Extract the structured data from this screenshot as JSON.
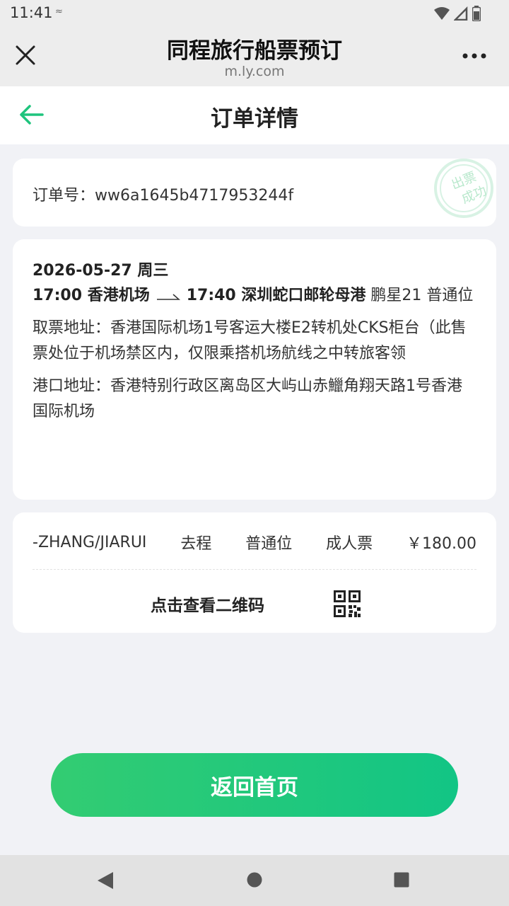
{
  "status_bar": {
    "time": "11:41",
    "note": "≈"
  },
  "webview": {
    "title": "同程旅行船票预订",
    "domain": "m.ly.com"
  },
  "page": {
    "title": "订单详情"
  },
  "order": {
    "number_label": "订单号：ww6a1645b4717953244f",
    "stamp_line1": "出票",
    "stamp_line2": "成功"
  },
  "trip": {
    "date": "2026-05-27 周三",
    "depart_time_place": "17:00 香港机场",
    "arrive_time_place": "17:40 深圳蛇口邮轮母港",
    "vessel_class": "鹏星21 普通位",
    "pickup_address": "取票地址：香港国际机场1号客运大楼E2转机处CKS柜台（此售票处位于机场禁区内，仅限乘搭机场航线之中转旅客领",
    "port_address": "港口地址：香港特别行政区离岛区大屿山赤鱲角翔天路1号香港国际机场"
  },
  "passenger": {
    "name": "-ZHANG/JIARUI",
    "direction": "去程",
    "seat": "普通位",
    "ticket_type": "成人票",
    "price": "￥180.00",
    "qr_label": "点击查看二维码"
  },
  "actions": {
    "home_button": "返回首页"
  },
  "colors": {
    "accent": "#1fc47d",
    "button_start": "#33cc72",
    "button_end": "#12c585"
  }
}
